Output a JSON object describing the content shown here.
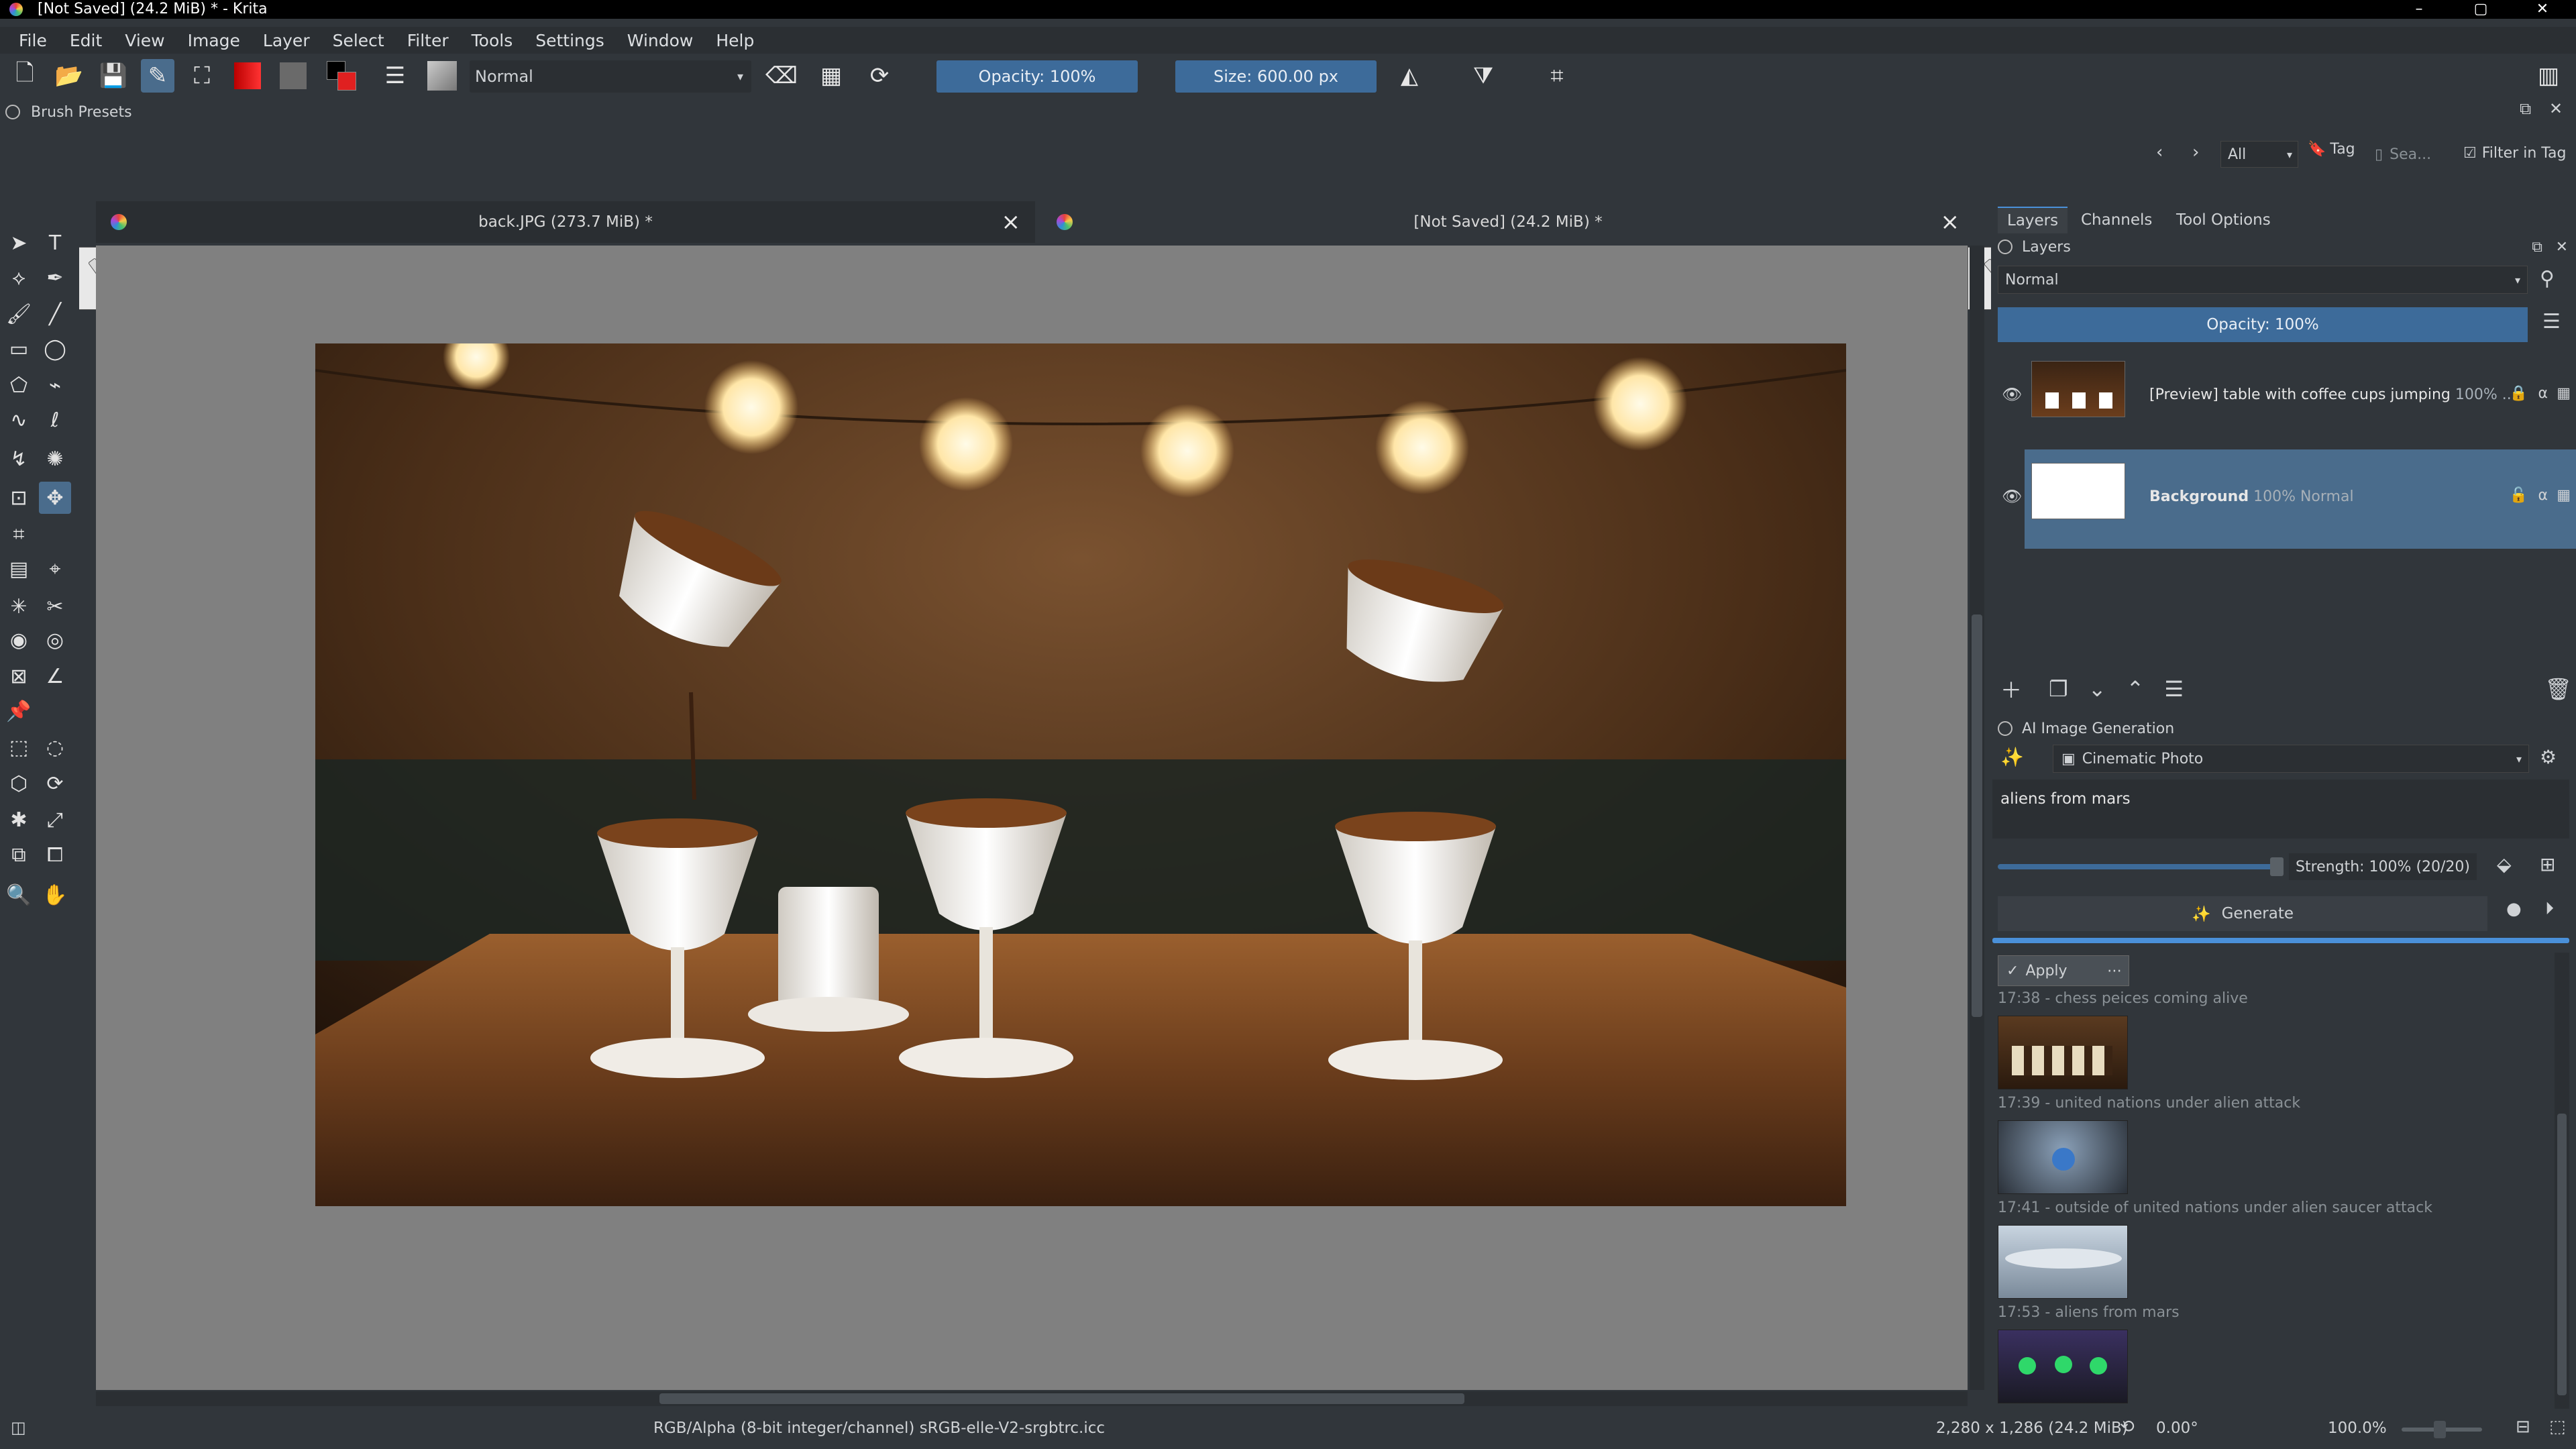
{
  "titlebar": {
    "title": "[Not Saved]  (24.2 MiB) * - Krita"
  },
  "menu": [
    "File",
    "Edit",
    "View",
    "Image",
    "Layer",
    "Select",
    "Filter",
    "Tools",
    "Settings",
    "Window",
    "Help"
  ],
  "toolbar": {
    "blend_mode": "Normal",
    "opacity": "Opacity: 100%",
    "size": "Size: 600.00 px"
  },
  "brush_presets": {
    "title": "Brush Presets",
    "tag_filter": "All",
    "tag_label": "Tag",
    "search_placeholder": "Sea...",
    "filter_in_tag": "Filter in Tag"
  },
  "documents": [
    {
      "title": "back.JPG (273.7 MiB) *"
    },
    {
      "title": "[Not Saved]  (24.2 MiB) *"
    }
  ],
  "dock_tabs": [
    "Layers",
    "Channels",
    "Tool Options"
  ],
  "layers_panel": {
    "title": "Layers",
    "blend_mode": "Normal",
    "opacity": "Opacity:  100%",
    "layers": [
      {
        "name": "[Preview] table with coffee cups jumping",
        "meta": "100% ..."
      },
      {
        "name": "Background",
        "meta": "100% Normal"
      }
    ]
  },
  "ai_panel": {
    "title": "AI Image Generation",
    "style": "Cinematic Photo",
    "prompt": "aliens from mars",
    "strength": "Strength: 100% (20/20)",
    "generate_label": "Generate",
    "apply_label": "Apply",
    "history": [
      {
        "caption": "17:38 - chess peices coming alive"
      },
      {
        "caption": "17:39 - united nations under alien attack"
      },
      {
        "caption": "17:41 - outside of united nations under alien saucer attack"
      },
      {
        "caption": "17:53 - aliens from mars"
      }
    ]
  },
  "statusbar": {
    "color_space": "RGB/Alpha (8-bit integer/channel)  sRGB-elle-V2-srgbtrc.icc",
    "dimensions": "2,280 x 1,286 (24.2 MiB)",
    "rotation": "0.00°",
    "zoom": "100.0%"
  },
  "colors": {
    "accent": "#4a6c8c",
    "panel_bg": "#31363b",
    "canvas_bg": "#808080",
    "opacity_field": "#3d6b9a"
  }
}
